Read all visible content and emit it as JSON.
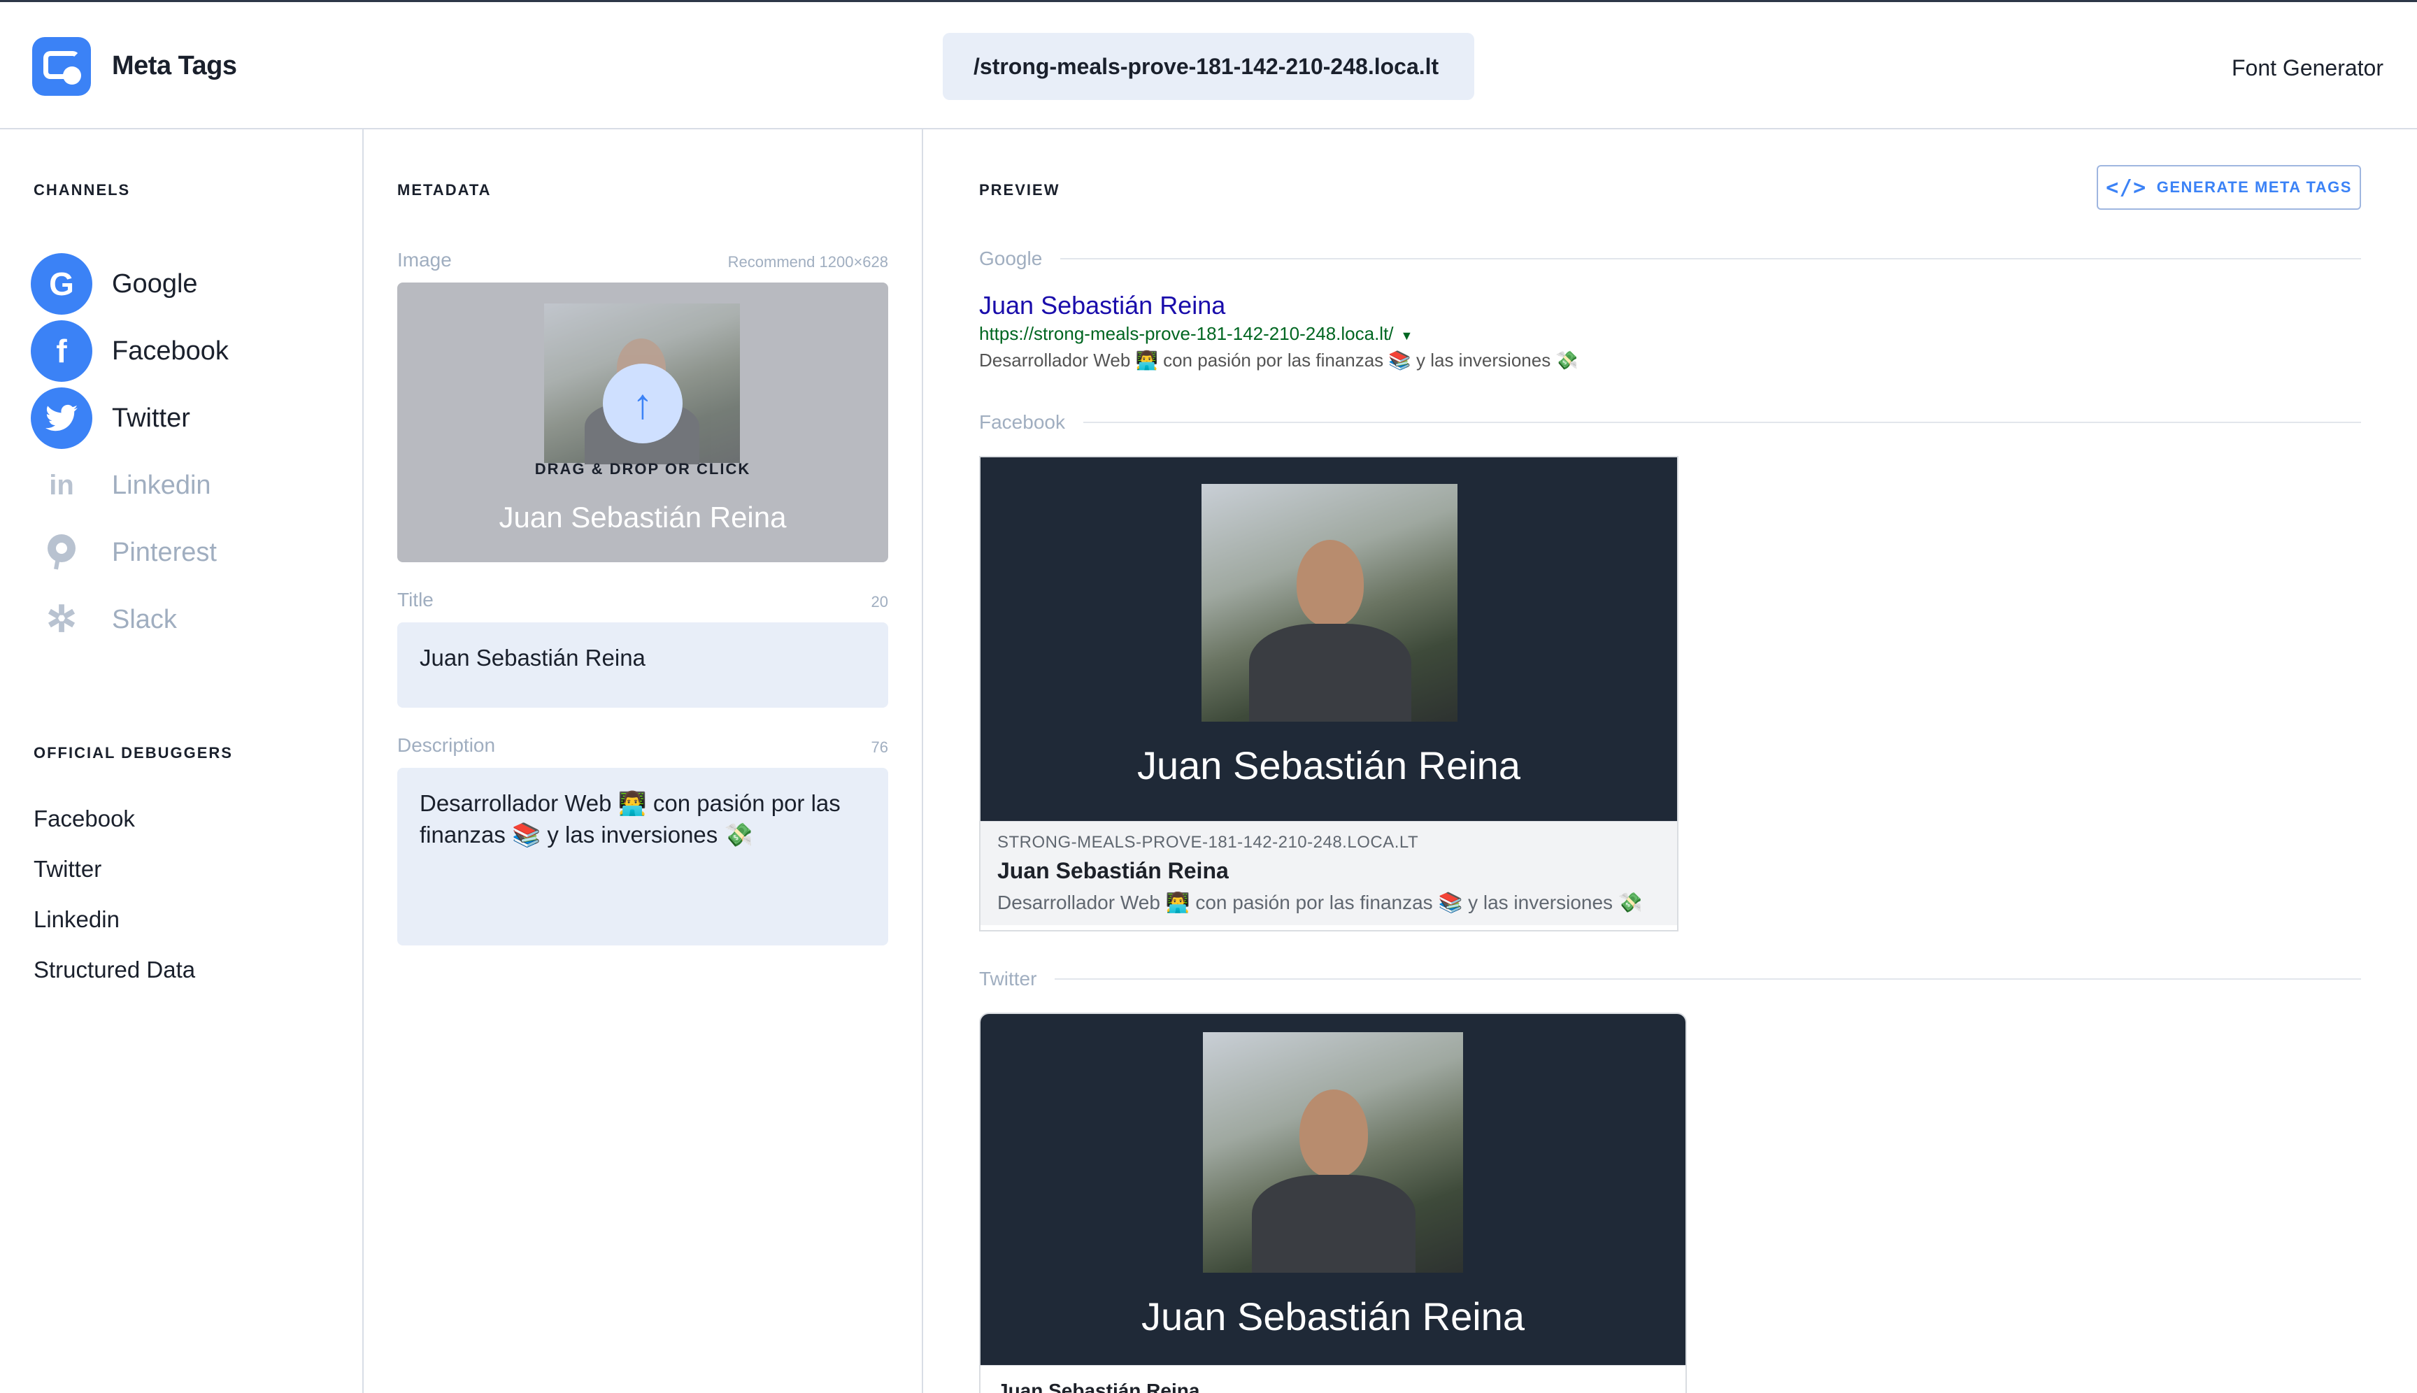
{
  "header": {
    "brand": "Meta Tags",
    "url_value": "/strong-meals-prove-181-142-210-248.loca.lt",
    "font_generator": "Font Generator"
  },
  "channels": {
    "heading": "CHANNELS",
    "items": [
      {
        "label": "Google",
        "icon": "google-icon",
        "active": true
      },
      {
        "label": "Facebook",
        "icon": "facebook-icon",
        "active": true
      },
      {
        "label": "Twitter",
        "icon": "twitter-icon",
        "active": true
      },
      {
        "label": "Linkedin",
        "icon": "linkedin-icon",
        "active": false
      },
      {
        "label": "Pinterest",
        "icon": "pinterest-icon",
        "active": false
      },
      {
        "label": "Slack",
        "icon": "slack-icon",
        "active": false
      }
    ]
  },
  "debuggers": {
    "heading": "OFFICIAL DEBUGGERS",
    "items": [
      "Facebook",
      "Twitter",
      "Linkedin",
      "Structured Data"
    ]
  },
  "metadata": {
    "heading": "METADATA",
    "image_label": "Image",
    "image_hint": "Recommend 1200×628",
    "drop_text": "DRAG & DROP OR CLICK",
    "image_name": "Juan Sebastián Reina",
    "title_label": "Title",
    "title_count": "20",
    "title_value": "Juan Sebastián Reina",
    "description_label": "Description",
    "description_count": "76",
    "description_value": "Desarrollador Web 👨‍💻 con pasión por las finanzas 📚 y las inversiones 💸"
  },
  "preview": {
    "heading": "PREVIEW",
    "generate_button": "GENERATE META TAGS",
    "google": {
      "section": "Google",
      "title": "Juan Sebastián Reina",
      "url": "https://strong-meals-prove-181-142-210-248.loca.lt/",
      "description": "Desarrollador Web 👨‍💻 con pasión por las finanzas 📚 y las inversiones 💸"
    },
    "facebook": {
      "section": "Facebook",
      "image_title": "Juan Sebastián Reina",
      "domain": "STRONG-MEALS-PROVE-181-142-210-248.LOCA.LT",
      "title": "Juan Sebastián Reina",
      "description": "Desarrollador Web 👨‍💻 con pasión por las finanzas 📚 y las inversiones 💸"
    },
    "twitter": {
      "section": "Twitter",
      "image_title": "Juan Sebastián Reina",
      "title": "Juan Sebastián Reina"
    }
  },
  "colors": {
    "accent": "#3b82f6",
    "card_dark": "#1f2937",
    "google_link": "#1a0dab",
    "google_url": "#006621"
  }
}
